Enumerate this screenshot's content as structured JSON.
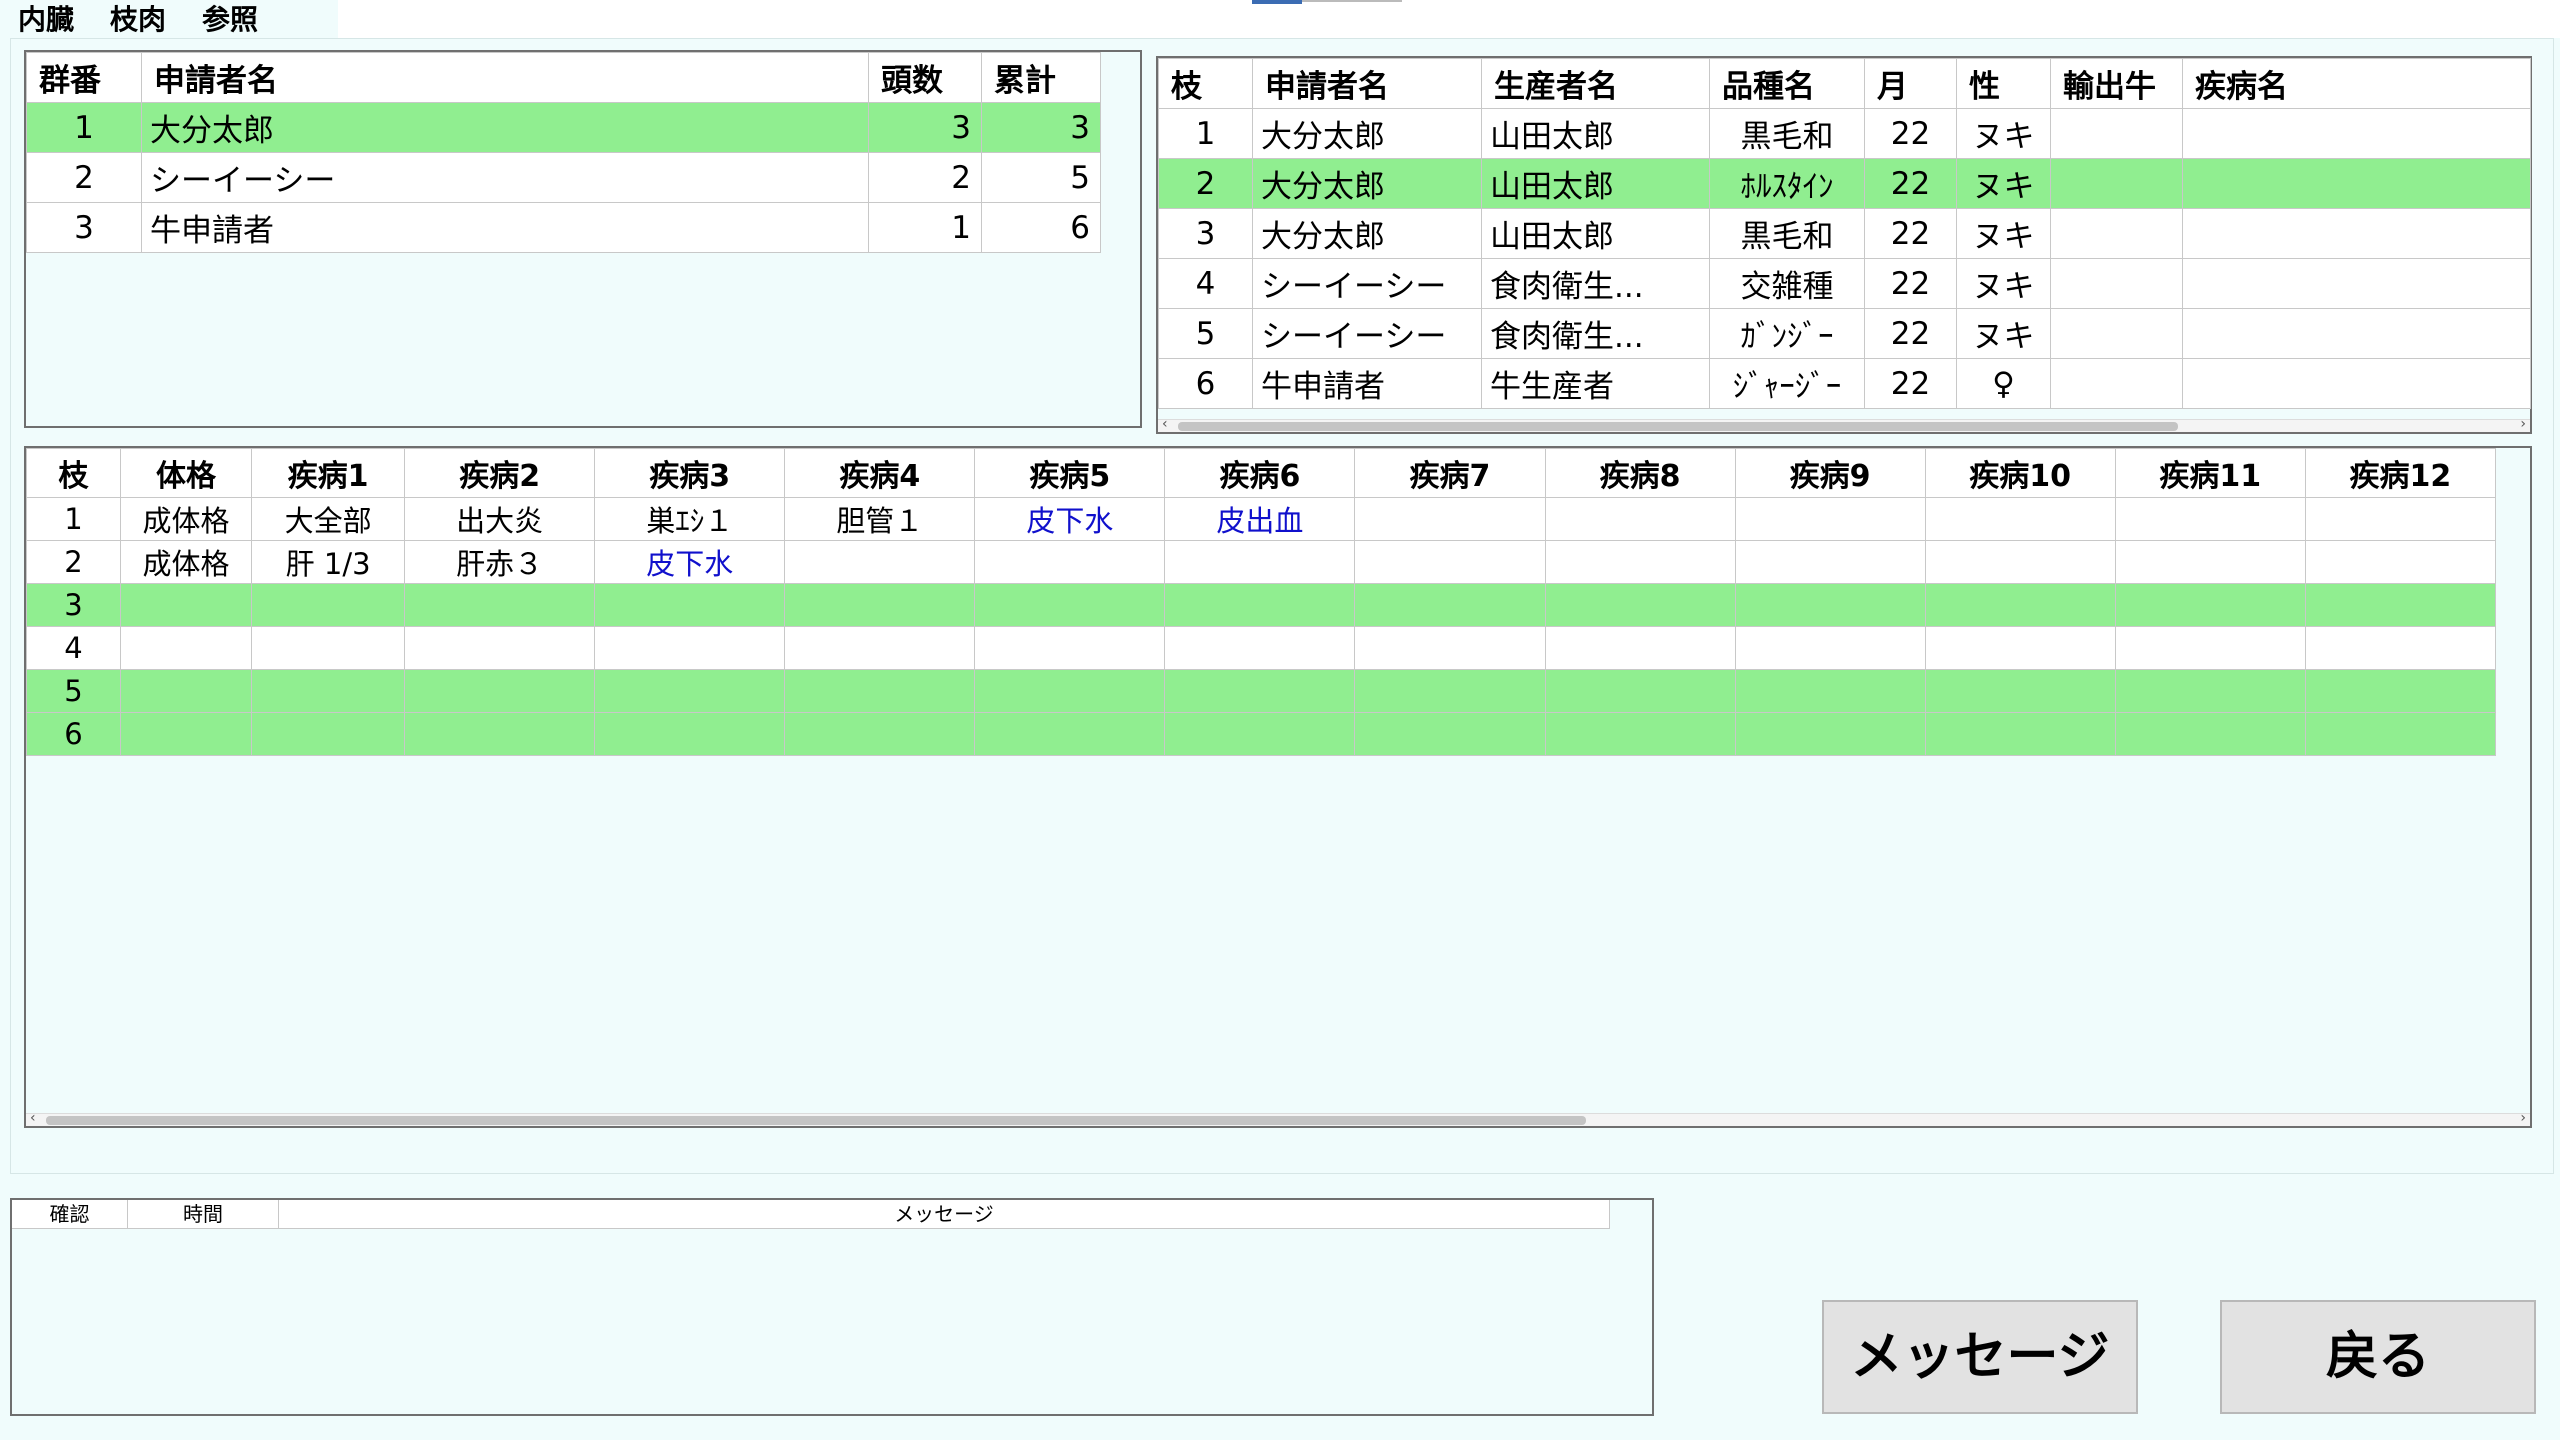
{
  "tabs": [
    {
      "label": "内臓"
    },
    {
      "label": "枝肉"
    },
    {
      "label": "参照"
    }
  ],
  "applicants": {
    "headers": [
      "群番",
      "申請者名",
      "頭数",
      "累計"
    ],
    "rows": [
      {
        "no": "1",
        "name": "大分太郎",
        "count": "3",
        "total": "3"
      },
      {
        "no": "2",
        "name": "シーイーシー",
        "count": "2",
        "total": "5"
      },
      {
        "no": "3",
        "name": "牛申請者",
        "count": "1",
        "total": "6"
      }
    ]
  },
  "branches": {
    "headers": [
      "枝",
      "申請者名",
      "生産者名",
      "品種名",
      "月",
      "性",
      "輸出牛",
      "疾病名"
    ],
    "rows": [
      {
        "no": "1",
        "applicant": "大分太郎",
        "producer": "山田太郎",
        "breed": "黒毛和",
        "month": "22",
        "sex": "ヌキ",
        "export": "",
        "disease": ""
      },
      {
        "no": "2",
        "applicant": "大分太郎",
        "producer": "山田太郎",
        "breed": "ﾎﾙｽﾀｲﾝ",
        "month": "22",
        "sex": "ヌキ",
        "export": "",
        "disease": ""
      },
      {
        "no": "3",
        "applicant": "大分太郎",
        "producer": "山田太郎",
        "breed": "黒毛和",
        "month": "22",
        "sex": "ヌキ",
        "export": "",
        "disease": ""
      },
      {
        "no": "4",
        "applicant": "シーイーシー",
        "producer": "食肉衛生...",
        "breed": "交雑種",
        "month": "22",
        "sex": "ヌキ",
        "export": "",
        "disease": ""
      },
      {
        "no": "5",
        "applicant": "シーイーシー",
        "producer": "食肉衛生...",
        "breed": "ｶﾞﾝｼﾞｰ",
        "month": "22",
        "sex": "ヌキ",
        "export": "",
        "disease": ""
      },
      {
        "no": "6",
        "applicant": "牛申請者",
        "producer": "牛生産者",
        "breed": "ｼﾞｬｰｼﾞｰ",
        "month": "22",
        "sex": "♀",
        "export": "",
        "disease": ""
      }
    ]
  },
  "diseases": {
    "headers": [
      "枝",
      "体格",
      "疾病1",
      "疾病2",
      "疾病3",
      "疾病4",
      "疾病5",
      "疾病6",
      "疾病7",
      "疾病8",
      "疾病9",
      "疾病10",
      "疾病11",
      "疾病12"
    ],
    "rows": [
      {
        "no": "1",
        "cells": [
          "成体格",
          "大全部",
          "出大炎",
          "巣ｴｼ１",
          "胆管１",
          "皮下水",
          "皮出血",
          "",
          "",
          "",
          "",
          "",
          ""
        ]
      },
      {
        "no": "2",
        "cells": [
          "成体格",
          "肝 1/3",
          "肝赤３",
          "皮下水",
          "",
          "",
          "",
          "",
          "",
          "",
          "",
          "",
          ""
        ]
      },
      {
        "no": "3",
        "cells": [
          "",
          "",
          "",
          "",
          "",
          "",
          "",
          "",
          "",
          "",
          "",
          "",
          ""
        ]
      },
      {
        "no": "4",
        "cells": [
          "",
          "",
          "",
          "",
          "",
          "",
          "",
          "",
          "",
          "",
          "",
          "",
          ""
        ]
      },
      {
        "no": "5",
        "cells": [
          "",
          "",
          "",
          "",
          "",
          "",
          "",
          "",
          "",
          "",
          "",
          "",
          ""
        ]
      },
      {
        "no": "6",
        "cells": [
          "",
          "",
          "",
          "",
          "",
          "",
          "",
          "",
          "",
          "",
          "",
          "",
          ""
        ]
      }
    ]
  },
  "messages": {
    "headers": [
      "確認",
      "時間",
      "メッセージ"
    ]
  },
  "buttons": {
    "message": "メッセージ",
    "back": "戻る"
  },
  "colors": {
    "selected_row": "#90ee90",
    "background": "#f0fcfc",
    "link_text": "#1010cc"
  }
}
